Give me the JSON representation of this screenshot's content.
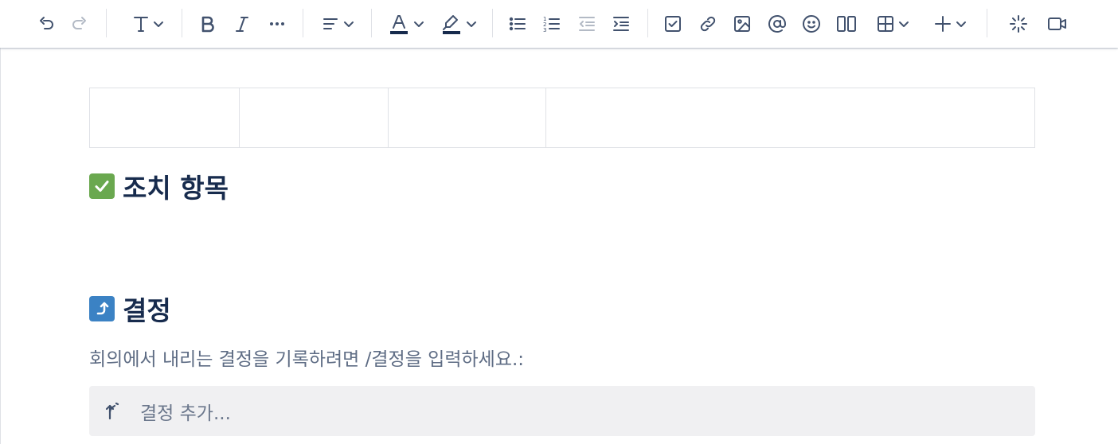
{
  "toolbar": {
    "items": [
      "undo-icon",
      "redo-icon",
      "text-style-icon",
      "bold-icon",
      "italic-icon",
      "more-icon",
      "align-icon",
      "text-color-icon",
      "highlight-icon",
      "bullet-list-icon",
      "numbered-list-icon",
      "outdent-icon",
      "indent-icon",
      "task-icon",
      "link-icon",
      "image-icon",
      "mention-icon",
      "emoji-icon",
      "layout-icon",
      "table-icon",
      "insert-icon",
      "ai-icon",
      "video-icon"
    ],
    "text_color": "#172b4d",
    "highlight_color": "#172b4d"
  },
  "colors": {
    "action_emoji": "#6aa84f",
    "decision_emoji": "#3b82c4"
  },
  "sections": {
    "action_items": {
      "emoji": "check-mark-button",
      "title": "조치 항목"
    },
    "decisions": {
      "emoji": "arrow-right-hook-up",
      "title": "결정",
      "description": "회의에서 내리는 결정을 기록하려면 /결정을 입력하세요.:",
      "placeholder": "결정 추가..."
    }
  }
}
